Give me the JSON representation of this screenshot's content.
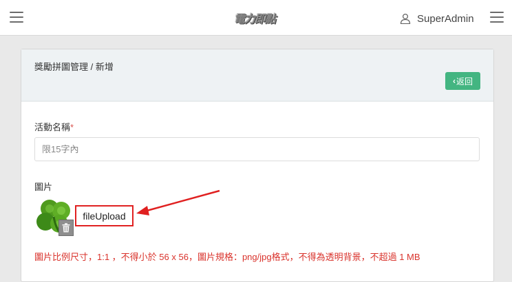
{
  "header": {
    "logo_text": "電力即點",
    "user_name": "SuperAdmin",
    "menu_icon": "hamburger-icon",
    "user_icon": "user-icon"
  },
  "card": {
    "breadcrumb": "獎勵拼圖管理 / 新增",
    "back_button": {
      "label": "返回",
      "icon": "chevron-left-icon",
      "color": "#43b581"
    }
  },
  "form": {
    "activity_name": {
      "label": "活動名稱",
      "required_mark": "*",
      "value": "",
      "placeholder": "限15字內"
    },
    "image": {
      "label": "圖片",
      "upload_label": "fileUpload",
      "delete_icon": "trash-icon",
      "thumbnail": "four-leaf-clover"
    },
    "hint": "圖片比例尺寸，1:1 ，不得小於 56 x 56，圖片規格：png/jpg格式，不得為透明背景，不超過 1 MB"
  },
  "colors": {
    "accent_green": "#43b581",
    "error_red": "#d9322b",
    "annotation_red": "#e02020"
  }
}
